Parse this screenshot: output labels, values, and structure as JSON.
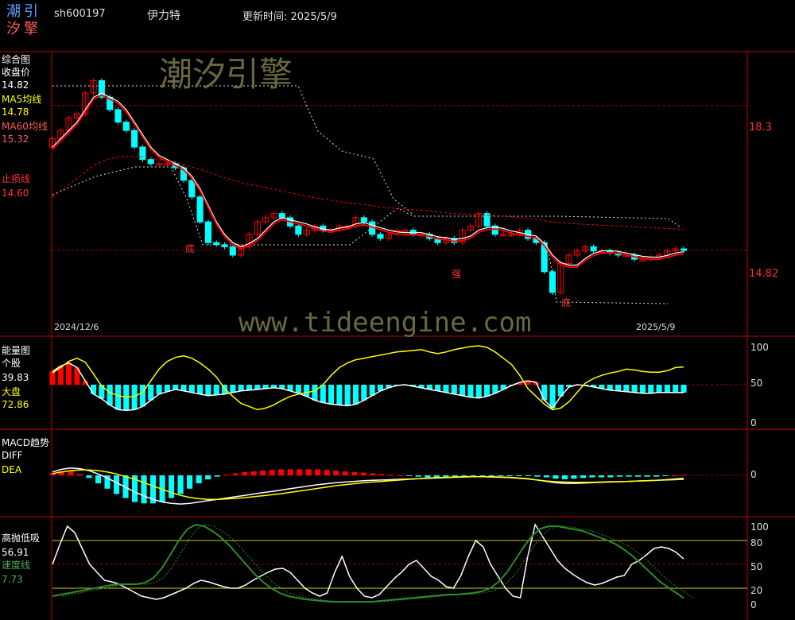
{
  "header": {
    "logo_line1": "潮引",
    "logo_line2": "汐擎",
    "code": "sh600197",
    "name": "伊力特",
    "update_label": "更新时间: 2025/5/9"
  },
  "watermark": {
    "brand": "潮汐引擎",
    "url": "www.tideengine.com"
  },
  "colors": {
    "up": "#ff0000",
    "down": "#00ffff",
    "ma5": "#ffffff",
    "ma60": "#ff0000",
    "diff": "#ffffff",
    "dea": "#ffff00",
    "frame": "#c00000"
  },
  "panels": {
    "price": {
      "title": "综合图",
      "close_label": "收盘价",
      "close_value": "14.82",
      "ma5_label": "MA5均线",
      "ma5_value": "14.78",
      "ma60_label": "MA60均线",
      "ma60_value": "15.32",
      "stop_label": "止损线",
      "stop_value": "14.60",
      "right_ticks": [
        "18.3",
        "14.82"
      ],
      "date_start": "2024/12/6",
      "date_end": "2025/5/9",
      "markers": [
        "底",
        "强",
        "底"
      ]
    },
    "energy": {
      "title": "能量图",
      "stock_label": "个股",
      "stock_value": "39.83",
      "market_label": "大盘",
      "market_value": "72.86",
      "right_ticks": [
        "100",
        "50",
        "0"
      ]
    },
    "macd": {
      "title": "MACD趋势",
      "diff_label": "DIFF",
      "dea_label": "DEA",
      "right_ticks": [
        "0"
      ]
    },
    "oscillator": {
      "title": "高抛低吸",
      "value": "56.91",
      "speed_label": "速度线",
      "speed_value": "7.73",
      "right_ticks": [
        "100",
        "80",
        "50",
        "20",
        "0"
      ]
    }
  },
  "chart_data": [
    {
      "type": "candlestick",
      "title": "综合图",
      "x_range": [
        "2024/12/6",
        "2025/5/9"
      ],
      "ylim": [
        12.9,
        19.5
      ],
      "series": [
        {
          "name": "收盘价",
          "close": [
            17.5,
            17.7,
            18.0,
            18.1,
            18.6,
            18.9,
            18.5,
            18.2,
            17.9,
            17.7,
            17.3,
            17.0,
            16.9,
            16.9,
            16.9,
            16.8,
            16.5,
            16.1,
            15.5,
            15.0,
            14.95,
            14.9,
            14.7,
            14.9,
            15.2,
            15.5,
            15.6,
            15.7,
            15.6,
            15.4,
            15.2,
            15.3,
            15.4,
            15.3,
            15.3,
            15.4,
            15.4,
            15.6,
            15.5,
            15.2,
            15.1,
            15.2,
            15.3,
            15.3,
            15.2,
            15.2,
            15.1,
            15.0,
            15.1,
            15.0,
            15.3,
            15.4,
            15.7,
            15.4,
            15.2,
            15.2,
            15.2,
            15.3,
            15.1,
            15.0,
            14.3,
            13.8,
            14.5,
            14.7,
            14.8,
            14.9,
            14.8,
            14.8,
            14.75,
            14.7,
            14.7,
            14.6,
            14.6,
            14.65,
            14.7,
            14.8,
            14.85,
            14.82
          ]
        },
        {
          "name": "MA5均线",
          "values": [
            17.3,
            17.5,
            17.7,
            17.9,
            18.2,
            18.5,
            18.6,
            18.5,
            18.4,
            18.2,
            17.9,
            17.6,
            17.3,
            17.1,
            17.0,
            16.9,
            16.8,
            16.6,
            16.3,
            15.9,
            15.5,
            15.2,
            15.0,
            14.9,
            14.98,
            15.1,
            15.3,
            15.5,
            15.6,
            15.55,
            15.5,
            15.45,
            15.38,
            15.33,
            15.3,
            15.35,
            15.38,
            15.45,
            15.48,
            15.42,
            15.36,
            15.3,
            15.26,
            15.24,
            15.24,
            15.24,
            15.2,
            15.14,
            15.12,
            15.08,
            15.1,
            15.16,
            15.3,
            15.36,
            15.38,
            15.34,
            15.28,
            15.24,
            15.2,
            15.16,
            14.98,
            14.7,
            14.52,
            14.46,
            14.46,
            14.62,
            14.74,
            14.8,
            14.81,
            14.79,
            14.75,
            14.71,
            14.67,
            14.65,
            14.65,
            14.69,
            14.75,
            14.78
          ]
        },
        {
          "name": "MA60均线",
          "values": [
            16.1,
            16.25,
            16.4,
            16.55,
            16.7,
            16.85,
            16.95,
            17.02,
            17.06,
            17.08,
            17.08,
            17.06,
            17.03,
            17.0,
            16.97,
            16.93,
            16.88,
            16.82,
            16.76,
            16.7,
            16.63,
            16.56,
            16.5,
            16.45,
            16.4,
            16.36,
            16.32,
            16.28,
            16.24,
            16.2,
            16.16,
            16.12,
            16.08,
            16.05,
            16.02,
            15.99,
            15.96,
            15.94,
            15.92,
            15.89,
            15.86,
            15.84,
            15.82,
            15.8,
            15.79,
            15.78,
            15.76,
            15.74,
            15.72,
            15.7,
            15.69,
            15.68,
            15.67,
            15.66,
            15.65,
            15.64,
            15.62,
            15.6,
            15.58,
            15.56,
            15.53,
            15.5,
            15.48,
            15.46,
            15.45,
            15.44,
            15.43,
            15.42,
            15.41,
            15.4,
            15.39,
            15.38,
            15.37,
            15.36,
            15.35,
            15.34,
            15.33,
            15.32
          ]
        }
      ]
    },
    {
      "type": "bar",
      "title": "能量图",
      "ylim": [
        0,
        100
      ],
      "series": [
        {
          "name": "个股",
          "values": [
            67,
            74,
            78,
            72,
            55,
            38,
            32,
            24,
            18,
            17,
            18,
            22,
            30,
            38,
            41,
            44,
            42,
            40,
            38,
            36,
            37,
            38,
            40,
            42,
            43,
            44,
            45,
            46,
            45,
            42,
            39,
            35,
            30,
            27,
            25,
            24,
            23,
            25,
            30,
            36,
            42,
            46,
            49,
            50,
            48,
            46,
            44,
            42,
            40,
            38,
            36,
            34,
            33,
            35,
            39,
            44,
            49,
            53,
            55,
            53,
            30,
            20,
            35,
            47,
            50,
            49,
            47,
            45,
            43,
            42,
            41,
            40,
            39,
            39,
            40,
            40,
            40,
            39.83
          ]
        },
        {
          "name": "大盘",
          "values": [
            65,
            72,
            80,
            84,
            79,
            64,
            48,
            40,
            36,
            34,
            35,
            40,
            55,
            70,
            80,
            85,
            87,
            84,
            78,
            70,
            60,
            45,
            35,
            26,
            22,
            18,
            20,
            24,
            30,
            35,
            38,
            40,
            42,
            50,
            62,
            72,
            78,
            82,
            84,
            86,
            88,
            90,
            92,
            93,
            94,
            95,
            92,
            90,
            92,
            95,
            97,
            99,
            100,
            98,
            92,
            84,
            76,
            62,
            45,
            35,
            25,
            18,
            20,
            28,
            40,
            52,
            58,
            62,
            65,
            67,
            70,
            69,
            67,
            66,
            66,
            68,
            72,
            72.86
          ]
        }
      ]
    },
    {
      "type": "bar",
      "title": "MACD趋势",
      "ylim": [
        -1.0,
        0.4
      ],
      "series": [
        {
          "name": "DIFF",
          "values": [
            0.1,
            0.18,
            0.22,
            0.2,
            0.14,
            0.04,
            -0.08,
            -0.22,
            -0.36,
            -0.5,
            -0.62,
            -0.72,
            -0.8,
            -0.84,
            -0.86,
            -0.84,
            -0.8,
            -0.76,
            -0.72,
            -0.68,
            -0.64,
            -0.6,
            -0.56,
            -0.52,
            -0.48,
            -0.44,
            -0.4,
            -0.36,
            -0.32,
            -0.28,
            -0.25,
            -0.22,
            -0.2,
            -0.18,
            -0.16,
            -0.15,
            -0.14,
            -0.13,
            -0.12,
            -0.11,
            -0.1,
            -0.09,
            -0.08,
            -0.07,
            -0.06,
            -0.05,
            -0.04,
            -0.04,
            -0.04,
            -0.05,
            -0.06,
            -0.08,
            -0.1,
            -0.14,
            -0.18,
            -0.22,
            -0.24,
            -0.24,
            -0.23,
            -0.22,
            -0.21,
            -0.2,
            -0.19,
            -0.18,
            -0.17,
            -0.16,
            -0.15,
            -0.13,
            -0.11,
            -0.09
          ]
        },
        {
          "name": "DEA",
          "values": [
            0.05,
            0.1,
            0.14,
            0.16,
            0.16,
            0.14,
            0.1,
            0.04,
            -0.04,
            -0.12,
            -0.22,
            -0.32,
            -0.42,
            -0.52,
            -0.6,
            -0.66,
            -0.7,
            -0.72,
            -0.72,
            -0.71,
            -0.69,
            -0.67,
            -0.64,
            -0.61,
            -0.58,
            -0.55,
            -0.51,
            -0.47,
            -0.43,
            -0.39,
            -0.35,
            -0.31,
            -0.28,
            -0.25,
            -0.22,
            -0.2,
            -0.18,
            -0.16,
            -0.14,
            -0.12,
            -0.1,
            -0.08,
            -0.07,
            -0.06,
            -0.05,
            -0.04,
            -0.04,
            -0.04,
            -0.05,
            -0.06,
            -0.07,
            -0.09,
            -0.11,
            -0.14,
            -0.17,
            -0.19,
            -0.2,
            -0.21,
            -0.21,
            -0.21,
            -0.2,
            -0.19,
            -0.19,
            -0.18,
            -0.17,
            -0.16,
            -0.15,
            -0.14,
            -0.13,
            -0.12
          ]
        }
      ]
    },
    {
      "type": "line",
      "title": "高抛低吸",
      "ylim": [
        0,
        100
      ],
      "series": [
        {
          "name": "高抛低吸",
          "values": [
            50,
            75,
            98,
            90,
            70,
            50,
            40,
            30,
            28,
            25,
            20,
            15,
            10,
            8,
            6,
            8,
            12,
            16,
            20,
            26,
            30,
            28,
            25,
            22,
            20,
            20,
            24,
            30,
            35,
            40,
            44,
            45,
            40,
            30,
            20,
            14,
            10,
            14,
            40,
            60,
            35,
            20,
            10,
            8,
            12,
            22,
            32,
            40,
            50,
            55,
            45,
            35,
            30,
            22,
            20,
            36,
            60,
            80,
            72,
            50,
            35,
            20,
            10,
            8,
            60,
            100,
            85,
            70,
            55,
            45,
            38,
            32,
            27,
            24,
            26,
            30,
            34,
            36,
            50,
            55,
            62,
            70,
            72,
            70,
            65,
            56.91
          ]
        },
        {
          "name": "速度线",
          "values": [
            10,
            12,
            14,
            16,
            18,
            20,
            22,
            24,
            25,
            25,
            25,
            27,
            33,
            45,
            62,
            80,
            94,
            100,
            98,
            92,
            84,
            74,
            62,
            50,
            38,
            28,
            20,
            14,
            10,
            8,
            6,
            5,
            4,
            3,
            3,
            3,
            3,
            3,
            3,
            4,
            5,
            6,
            7,
            8,
            9,
            10,
            11,
            12,
            12,
            13,
            14,
            16,
            20,
            28,
            40,
            56,
            72,
            86,
            95,
            98,
            98,
            96,
            94,
            92,
            88,
            84,
            80,
            75,
            68,
            60,
            50,
            40,
            30,
            22,
            15,
            7.73
          ]
        }
      ]
    }
  ]
}
